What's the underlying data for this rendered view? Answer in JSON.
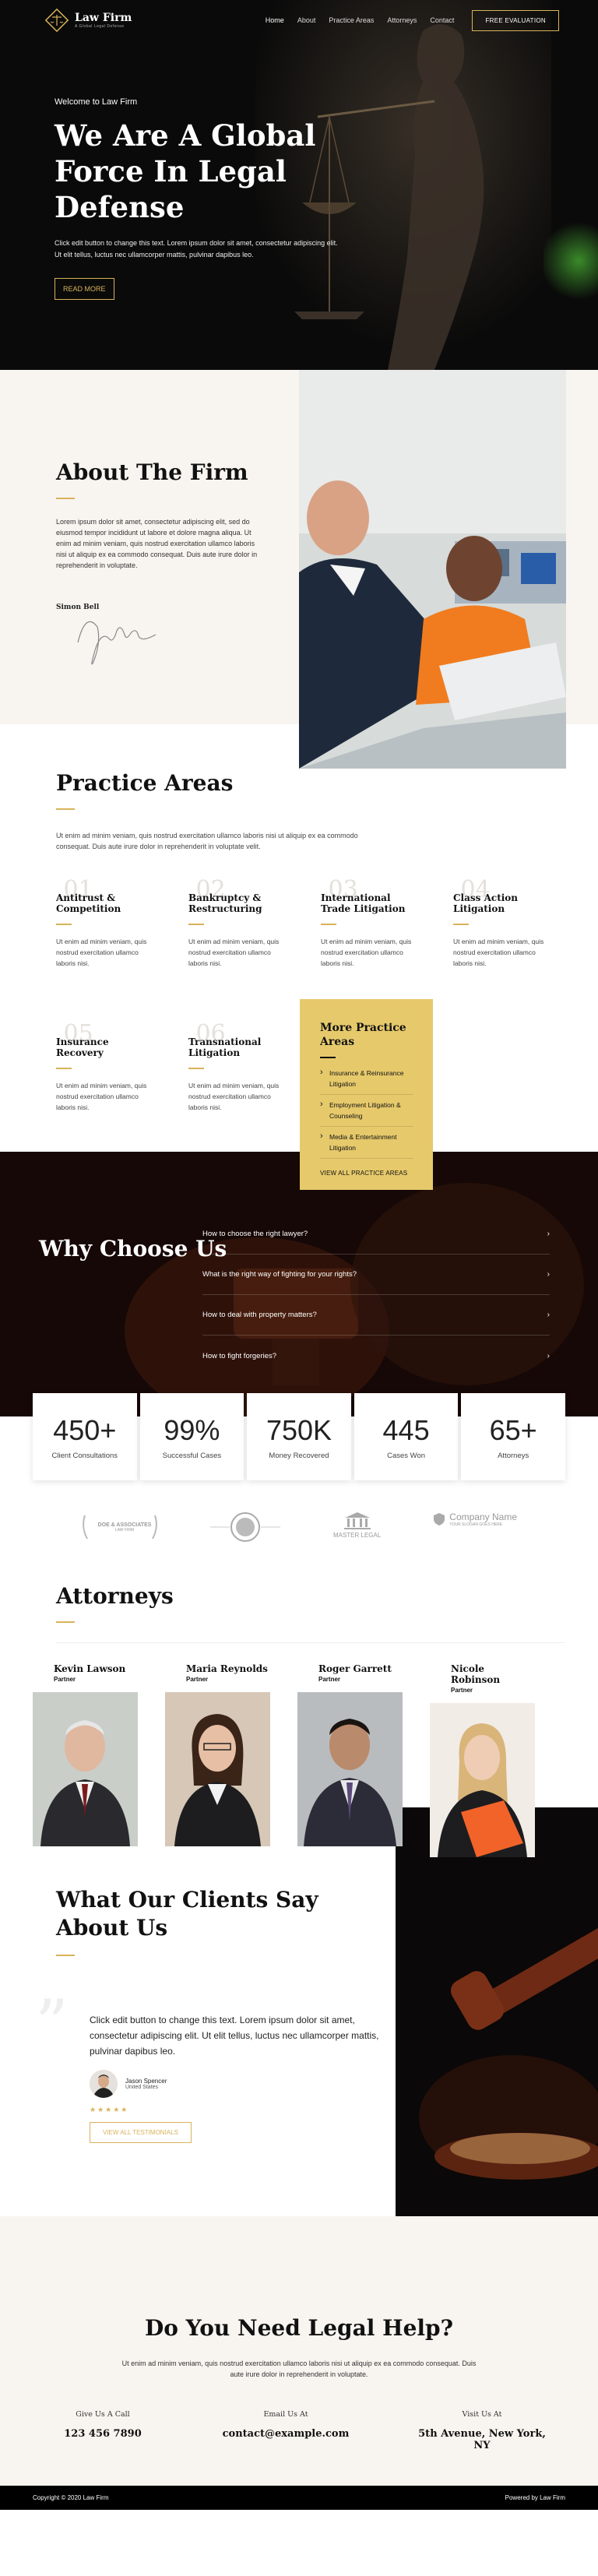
{
  "nav": {
    "logo_name": "Law Firm",
    "logo_tagline": "A Global Legal Defense",
    "links": [
      "Home",
      "About",
      "Practice Areas",
      "Attorneys",
      "Contact"
    ],
    "cta": "FREE EVALUATION"
  },
  "hero": {
    "eyebrow": "Welcome to Law Firm",
    "title": "We Are A Global Force In Legal Defense",
    "text": "Click edit button to change this text. Lorem ipsum dolor sit amet, consectetur adipiscing elit. Ut elit tellus, luctus nec ullamcorper mattis, pulvinar dapibus leo.",
    "button": "READ MORE"
  },
  "about": {
    "title": "About The Firm",
    "text": "Lorem ipsum dolor sit amet, consectetur adipiscing elit, sed do eiusmod tempor incididunt ut labore et dolore magna aliqua. Ut enim ad minim veniam, quis nostrud exercitation ullamco laboris nisi ut aliquip ex ea commodo consequat. Duis aute irure dolor in reprehenderit in voluptate.",
    "signature_name": "Simon Bell"
  },
  "practice": {
    "title": "Practice Areas",
    "intro": "Ut enim ad minim veniam, quis nostrud exercitation ullamco laboris nisi ut aliquip ex ea commodo consequat. Duis aute irure dolor in reprehenderit in voluptate velit.",
    "areas": [
      {
        "num": ".01",
        "title": "Antitrust & Competition",
        "text": "Ut enim ad minim veniam, quis nostrud exercitation ullamco laboris nisi."
      },
      {
        "num": ".02",
        "title": "Bankruptcy & Restructuring",
        "text": "Ut enim ad minim veniam, quis nostrud exercitation ullamco laboris nisi."
      },
      {
        "num": ".03",
        "title": "International Trade Litigation",
        "text": "Ut enim ad minim veniam, quis nostrud exercitation ullamco laboris nisi."
      },
      {
        "num": ".04",
        "title": "Class Action Litigation",
        "text": "Ut enim ad minim veniam, quis nostrud exercitation ullamco laboris nisi."
      },
      {
        "num": ".05",
        "title": "Insurance Recovery",
        "text": "Ut enim ad minim veniam, quis nostrud exercitation ullamco laboris nisi."
      },
      {
        "num": ".06",
        "title": "Transnational Litigation",
        "text": "Ut enim ad minim veniam, quis nostrud exercitation ullamco laboris nisi."
      }
    ],
    "more": {
      "title": "More Practice Areas",
      "items": [
        "Insurance & Reinsurance Litigation",
        "Employment Litigation & Counseling",
        "Media & Entertainment Litigation"
      ],
      "link": "VIEW ALL PRACTICE AREAS"
    }
  },
  "why": {
    "title": "Why Choose Us",
    "faqs": [
      "How to choose the right lawyer?",
      "What is the right way of fighting for your rights?",
      "How to deal with property matters?",
      "How to fight forgeries?"
    ]
  },
  "stats": [
    {
      "value": "450+",
      "label": "Client Consultations"
    },
    {
      "value": "99%",
      "label": "Successful Cases"
    },
    {
      "value": "750K",
      "label": "Money Recovered"
    },
    {
      "value": "445",
      "label": "Cases Won"
    },
    {
      "value": "65+",
      "label": "Attorneys"
    }
  ],
  "partner_logos": [
    {
      "name": "DOE & ASSOCIATES",
      "sub": "LAW FIRM"
    },
    {
      "name": "",
      "sub": ""
    },
    {
      "name": "MASTER LEGAL",
      "sub": ""
    },
    {
      "name": "Company Name",
      "sub": "YOUR SLOGAN GOES HERE"
    }
  ],
  "attorneys": {
    "title": "Attorneys",
    "people": [
      {
        "name": "Kevin Lawson",
        "role": "Partner"
      },
      {
        "name": "Maria Reynolds",
        "role": "Partner"
      },
      {
        "name": "Roger Garrett",
        "role": "Partner"
      },
      {
        "name": "Nicole Robinson",
        "role": "Partner"
      }
    ]
  },
  "testimonials": {
    "title": "What Our Clients Say About Us",
    "quote": "Click edit button to change this text. Lorem ipsum dolor sit amet, consectetur adipiscing elit. Ut elit tellus, luctus nec ullamcorper mattis, pulvinar dapibus leo.",
    "client_name": "Jason Spencer",
    "client_location": "United States",
    "stars": "★★★★★",
    "button": "VIEW ALL TESTIMONIALS"
  },
  "cta": {
    "title": "Do You Need Legal Help?",
    "text": "Ut enim ad minim veniam, quis nostrud exercitation ullamco laboris nisi ut aliquip ex ea commodo consequat. Duis aute irure dolor in reprehenderit in voluptate.",
    "contacts": [
      {
        "label": "Give Us A Call",
        "value": "123 456 7890"
      },
      {
        "label": "Email Us At",
        "value": "contact@example.com"
      },
      {
        "label": "Visit Us At",
        "value": "5th Avenue, New York, NY"
      }
    ]
  },
  "footer": {
    "copyright": "Copyright © 2020 Law Firm",
    "powered": "Powered by Law Firm"
  },
  "colors": {
    "gold": "#d8b35a",
    "dark": "#0a0a0a",
    "cream": "#f8f5f0",
    "box_yellow": "#e6c96b"
  }
}
